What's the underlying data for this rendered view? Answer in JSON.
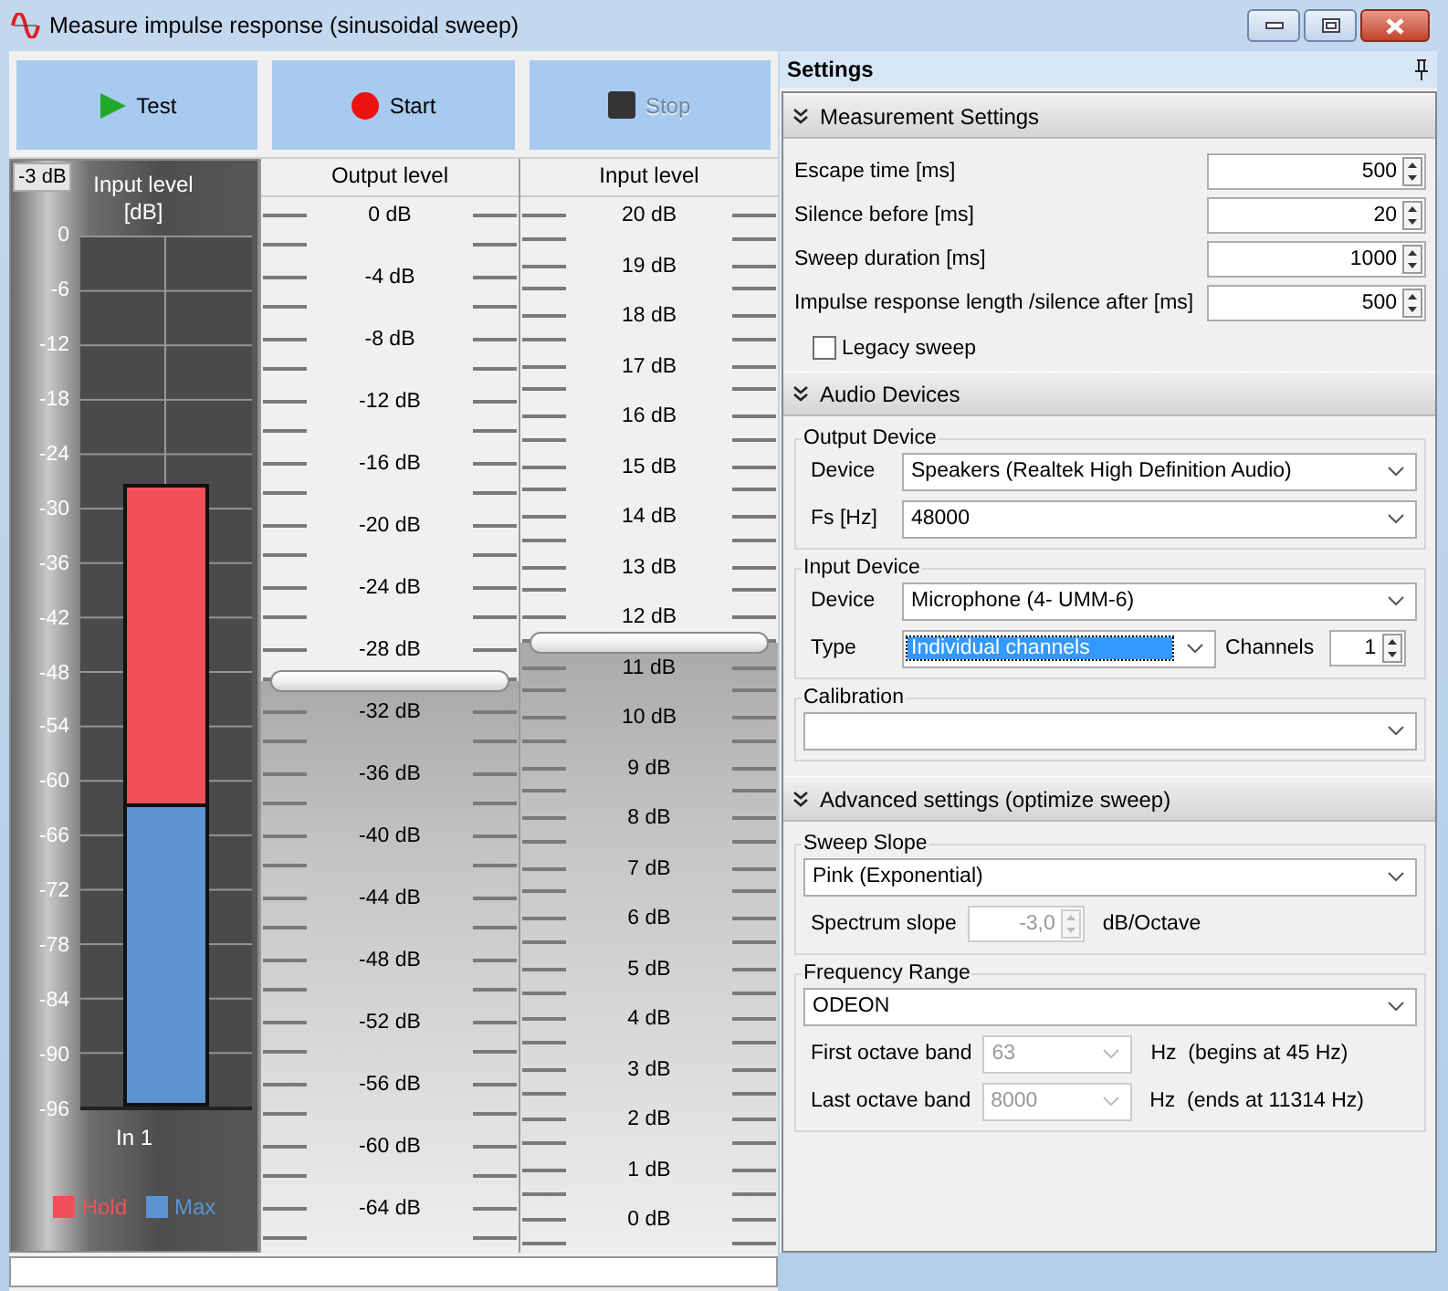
{
  "window": {
    "title": "Measure impulse response (sinusoidal sweep)"
  },
  "toolbar": [
    {
      "label": "Test",
      "kind": "play",
      "disabled": false
    },
    {
      "label": "Start",
      "kind": "record",
      "disabled": false
    },
    {
      "label": "Stop",
      "kind": "stop",
      "disabled": true
    }
  ],
  "meter": {
    "reference": "-3 dB",
    "title": "Input level",
    "unit": "[dB]",
    "scale": [
      "0",
      "-6",
      "-12",
      "-18",
      "-24",
      "-30",
      "-36",
      "-42",
      "-48",
      "-54",
      "-60",
      "-66",
      "-72",
      "-78",
      "-84",
      "-90",
      "-96"
    ],
    "channel": "In 1",
    "bars": [
      {
        "name": "Hold",
        "color": "#f0505a",
        "level": 0.714
      },
      {
        "name": "Max",
        "color": "#5b94d0",
        "level": 0.347
      }
    ]
  },
  "sliders": [
    {
      "title": "Output level",
      "scale": [
        "0 dB",
        "-4 dB",
        "-8 dB",
        "-12 dB",
        "-16 dB",
        "-20 dB",
        "-24 dB",
        "-28 dB",
        "-32 dB",
        "-36 dB",
        "-40 dB",
        "-44 dB",
        "-48 dB",
        "-52 dB",
        "-56 dB",
        "-60 dB",
        "-64 dB"
      ],
      "level": 0.541
    },
    {
      "title": "Input level",
      "scale": [
        "20 dB",
        "19 dB",
        "18 dB",
        "17 dB",
        "16 dB",
        "15 dB",
        "14 dB",
        "13 dB",
        "12 dB",
        "11 dB",
        "10 dB",
        "9 dB",
        "8 dB",
        "7 dB",
        "6 dB",
        "5 dB",
        "4 dB",
        "3 dB",
        "2 dB",
        "1 dB",
        "0 dB"
      ],
      "level": 0.578
    }
  ],
  "settings": {
    "title": "Settings",
    "sections": [
      {
        "title": "Measurement Settings",
        "expanded": true,
        "rows": [
          {
            "kind": "spin",
            "label": "Escape time [ms]",
            "value": "500"
          },
          {
            "kind": "spin",
            "label": "Silence before [ms]",
            "value": "20"
          },
          {
            "kind": "spin",
            "label": "Sweep duration [ms]",
            "value": "1000"
          },
          {
            "kind": "spin",
            "label": "Impulse response length /silence after [ms]",
            "value": "500"
          },
          {
            "kind": "check",
            "label": "Legacy sweep",
            "checked": false
          }
        ]
      },
      {
        "title": "Audio Devices",
        "expanded": true,
        "rows": [
          {
            "kind": "group",
            "title": "Output Device",
            "rows": [
              {
                "items": [
                  {
                    "kind": "label",
                    "text": "Device"
                  },
                  {
                    "kind": "select",
                    "value": "Speakers (Realtek High Definition Audio)",
                    "disabled": false,
                    "highlighted": false
                  }
                ]
              },
              {
                "items": [
                  {
                    "kind": "label",
                    "text": "Fs [Hz]"
                  },
                  {
                    "kind": "select",
                    "value": "48000",
                    "disabled": false,
                    "highlighted": false
                  }
                ]
              }
            ]
          },
          {
            "kind": "group",
            "title": "Input Device",
            "rows": [
              {
                "items": [
                  {
                    "kind": "label",
                    "text": "Device"
                  },
                  {
                    "kind": "select",
                    "value": "Microphone (4- UMM-6)",
                    "disabled": false,
                    "highlighted": false
                  }
                ]
              },
              {
                "items": [
                  {
                    "kind": "label",
                    "text": "Type"
                  },
                  {
                    "kind": "select",
                    "value": "Individual channels",
                    "disabled": false,
                    "highlighted": true
                  },
                  {
                    "kind": "label",
                    "text": "Channels"
                  },
                  {
                    "kind": "spin",
                    "value": "1",
                    "disabled": false
                  }
                ]
              }
            ]
          },
          {
            "kind": "group",
            "title": "Calibration",
            "rows": [
              {
                "items": [
                  {
                    "kind": "select",
                    "disabled": false,
                    "highlighted": false
                  }
                ]
              }
            ]
          }
        ]
      },
      {
        "title": "Advanced settings (optimize sweep)",
        "expanded": true,
        "rows": [
          {
            "kind": "group",
            "title": "Sweep Slope",
            "rows": [
              {
                "items": [
                  {
                    "kind": "select",
                    "value": "Pink (Exponential)",
                    "disabled": false,
                    "highlighted": false
                  }
                ]
              },
              {
                "items": [
                  {
                    "kind": "label",
                    "text": "Spectrum slope"
                  },
                  {
                    "kind": "spin",
                    "value": "-3,0",
                    "disabled": true
                  },
                  {
                    "kind": "text",
                    "text": "dB/Octave"
                  }
                ]
              }
            ]
          },
          {
            "kind": "group",
            "title": "Frequency Range",
            "rows": [
              {
                "items": [
                  {
                    "kind": "select",
                    "value": "ODEON",
                    "disabled": false,
                    "highlighted": false
                  }
                ]
              },
              {
                "items": [
                  {
                    "kind": "label",
                    "text": "First octave band"
                  },
                  {
                    "kind": "select",
                    "value": "63",
                    "disabled": true,
                    "highlighted": false
                  },
                  {
                    "kind": "text",
                    "text": "Hz  (begins at 45 Hz)"
                  }
                ]
              },
              {
                "items": [
                  {
                    "kind": "label",
                    "text": "Last octave band"
                  },
                  {
                    "kind": "select",
                    "value": "8000",
                    "disabled": true,
                    "highlighted": false
                  },
                  {
                    "kind": "text",
                    "text": "Hz  (ends at 11314 Hz)"
                  }
                ]
              }
            ]
          }
        ]
      }
    ]
  }
}
